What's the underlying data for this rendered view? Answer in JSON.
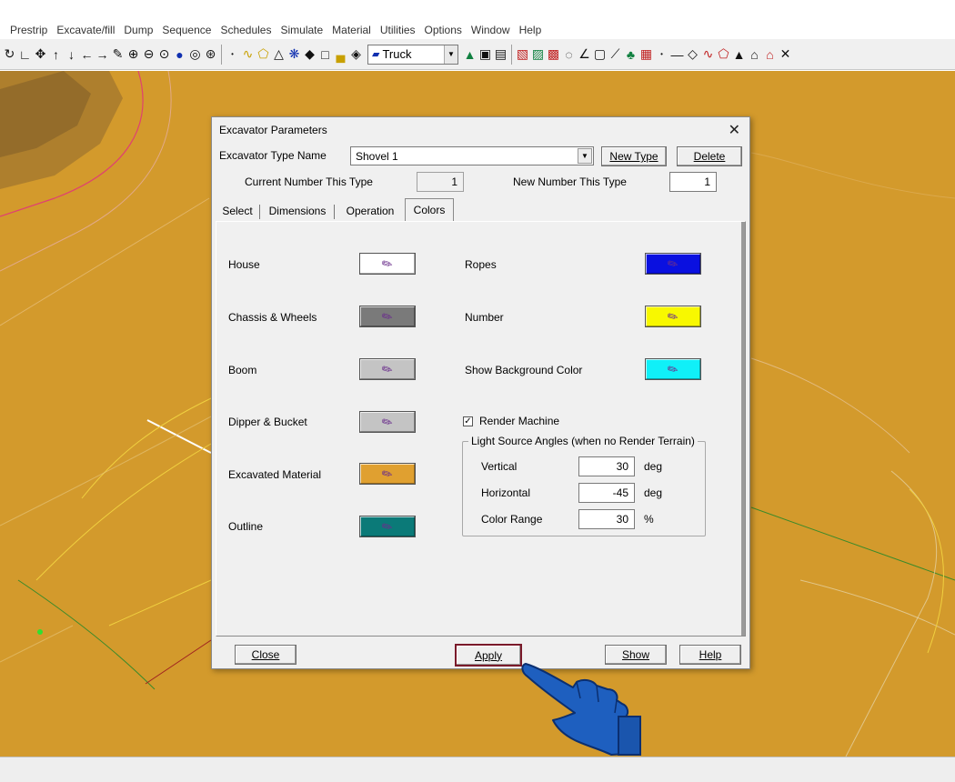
{
  "menubar": {
    "items": [
      "Prestrip",
      "Excavate/fill",
      "Dump",
      "Sequence",
      "Schedules",
      "Simulate",
      "Material",
      "Utilities",
      "Options",
      "Window",
      "Help"
    ]
  },
  "toolbar": {
    "truck_combo_value": "Truck",
    "icons": [
      "rotate-icon",
      "angle-icon",
      "move-icon",
      "arrow-up-icon",
      "arrow-down-icon",
      "arrow-left-icon",
      "arrow-right-icon",
      "pencil-icon",
      "zoom-in-icon",
      "zoom-out-icon",
      "zoom-window-icon",
      "sphere-icon",
      "target-icon",
      "zoom-extents-icon"
    ]
  },
  "dialog": {
    "title": "Excavator Parameters",
    "type_name_label": "Excavator Type Name",
    "type_name_value": "Shovel 1",
    "new_type_label": "New Type",
    "delete_label": "Delete",
    "current_number_label": "Current Number This Type",
    "current_number_value": "1",
    "new_number_label": "New Number This Type",
    "new_number_value": "1",
    "tabs": [
      {
        "label": "Select"
      },
      {
        "label": "Dimensions"
      },
      {
        "label": "Operation"
      },
      {
        "label": "Colors"
      }
    ],
    "colors_left": [
      {
        "label": "House",
        "color": "#ffffff"
      },
      {
        "label": "Chassis & Wheels",
        "color": "#7a7a7a"
      },
      {
        "label": "Boom",
        "color": "#c4c4c4"
      },
      {
        "label": "Dipper & Bucket",
        "color": "#c4c4c4"
      },
      {
        "label": "Excavated Material",
        "color": "#e0a030"
      },
      {
        "label": "Outline",
        "color": "#0b7a78"
      }
    ],
    "colors_right": [
      {
        "label": "Ropes",
        "color": "#0a10e0"
      },
      {
        "label": "Number",
        "color": "#f8f800"
      },
      {
        "label": "Show Background Color",
        "color": "#10f0f8"
      }
    ],
    "render_machine_label": "Render Machine",
    "render_machine_checked": "✓",
    "light_group_title": "Light Source Angles (when no Render Terrain)",
    "vertical_label": "Vertical",
    "vertical_value": "30",
    "vertical_unit": "deg",
    "horizontal_label": "Horizontal",
    "horizontal_value": "-45",
    "horizontal_unit": "deg",
    "color_range_label": "Color Range",
    "color_range_value": "30",
    "color_range_unit": "%",
    "close_label": "Close",
    "apply_label": "Apply",
    "show_label": "Show",
    "help_label": "Help"
  },
  "colors": {
    "terrain": "#d39a2c",
    "apply_highlight": "#7a1a2a",
    "pointer_hand": "#1e5fbf"
  }
}
